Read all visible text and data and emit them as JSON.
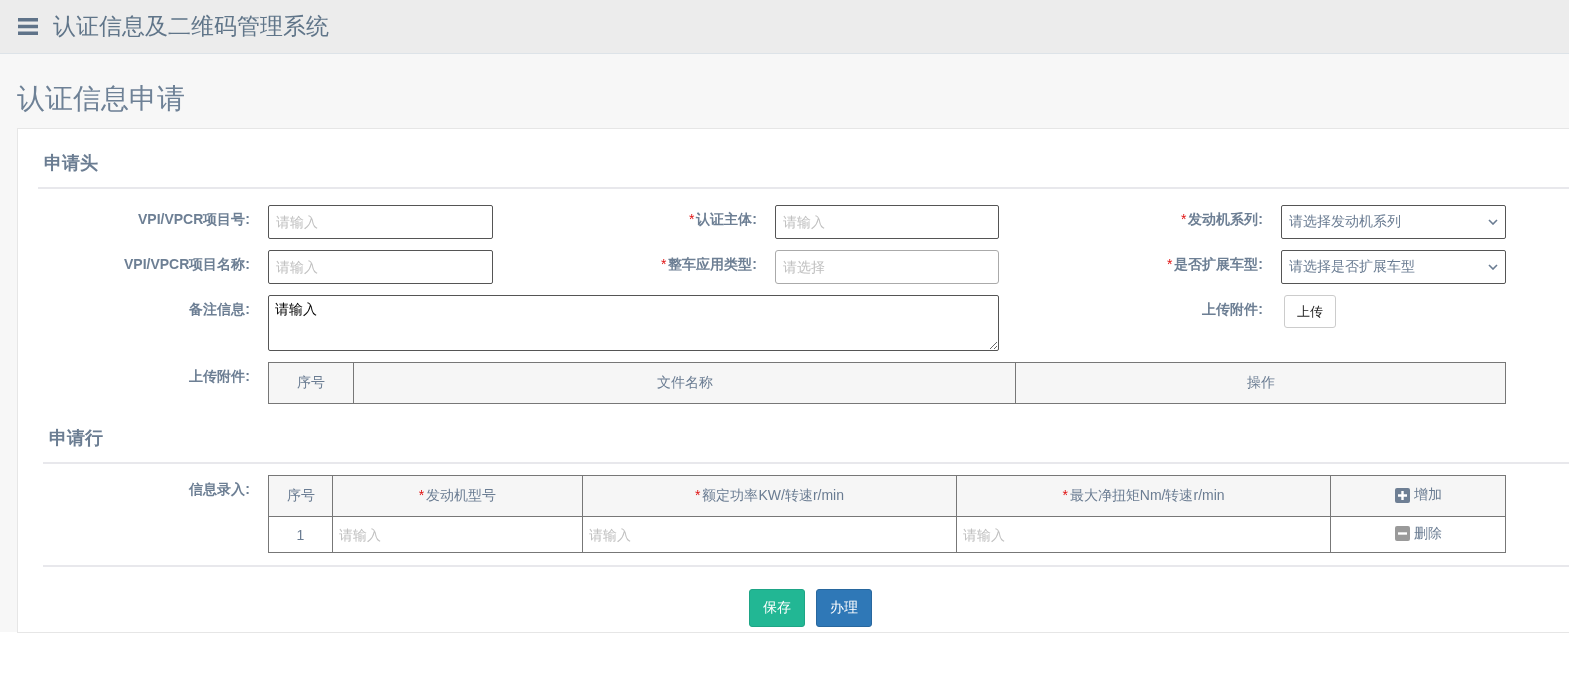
{
  "app_title": "认证信息及二维码管理系统",
  "page_title": "认证信息申请",
  "header_section": {
    "title": "申请头",
    "fields": [
      {
        "kind": "input",
        "label": "VPI/VPCR项目号:",
        "placeholder": "请输入"
      },
      {
        "kind": "input",
        "label": "认证主体:",
        "mark": "*",
        "placeholder": "请输入"
      },
      {
        "kind": "select",
        "label": "发动机系列:",
        "mark": "*",
        "value": "请选择发动机系列"
      },
      {
        "kind": "input",
        "label": "VPI/VPCR项目名称:",
        "placeholder": "请输入"
      },
      {
        "kind": "picker",
        "label": "整车应用类型:",
        "mark": "*",
        "placeholder": "请选择"
      },
      {
        "kind": "select",
        "label": "是否扩展车型:",
        "mark": "*",
        "value": "请选择是否扩展车型"
      },
      {
        "kind": "textarea",
        "label": "备注信息:",
        "value": "请输入"
      },
      {
        "kind": "upload",
        "label": "上传附件:",
        "button": "上传"
      }
    ],
    "attachments": {
      "label": "上传附件:",
      "columns": [
        "序号",
        "文件名称",
        "操作"
      ]
    }
  },
  "lines_section": {
    "title": "申请行",
    "label": "信息录入:",
    "columns": [
      {
        "kind": "text",
        "text": "序号"
      },
      {
        "kind": "text",
        "text": "发动机型号",
        "mark": "*"
      },
      {
        "kind": "text",
        "text": "额定功率KW/转速r/min",
        "mark": "*"
      },
      {
        "kind": "text",
        "text": "最大净扭矩Nm/转速r/min",
        "mark": "*"
      },
      {
        "kind": "add",
        "text": "增加"
      }
    ],
    "rows": [
      {
        "cells": [
          {
            "kind": "text",
            "text": "1"
          },
          {
            "kind": "input",
            "placeholder": "请输入"
          },
          {
            "kind": "input",
            "placeholder": "请输入"
          },
          {
            "kind": "input",
            "placeholder": "请输入"
          },
          {
            "kind": "delete",
            "text": "删除"
          }
        ]
      }
    ]
  },
  "buttons": [
    {
      "kind": "save",
      "label": "保存"
    },
    {
      "kind": "submit",
      "label": "办理"
    }
  ]
}
